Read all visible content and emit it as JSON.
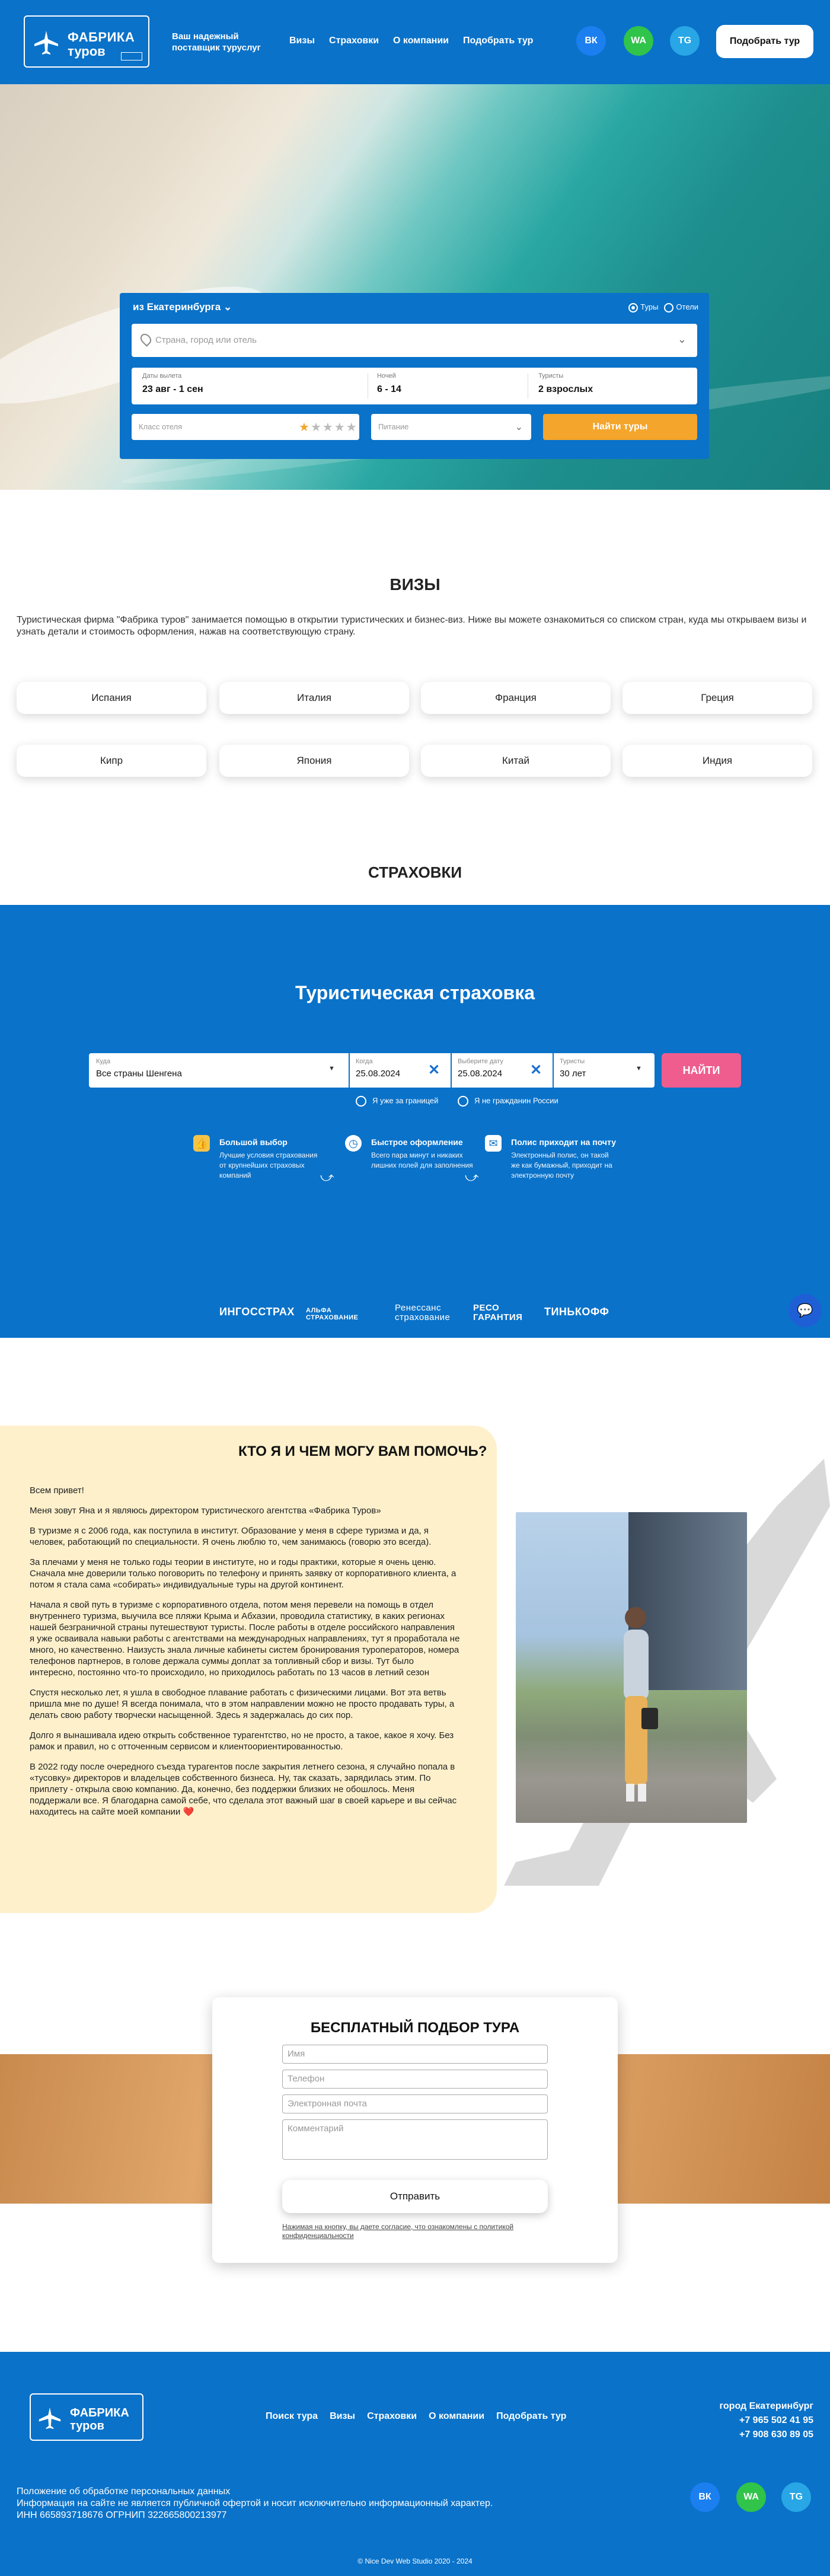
{
  "header": {
    "logo_line1": "ФАБРИКА",
    "logo_line2": "туров",
    "tagline": "Ваш надежный поставщик туруслуг",
    "nav": [
      "Визы",
      "Страховки",
      "О компании",
      "Подобрать тур"
    ],
    "social": [
      "ВК",
      "WA",
      "TG"
    ],
    "cta": "Подобрать тур"
  },
  "hero": {
    "from": "из Екатеринбурга ⌄",
    "radio_tours": "Туры",
    "radio_hotels": "Отели",
    "dest_placeholder": "Страна, город или отель",
    "dates_label": "Даты вылета",
    "dates_value": "23 авг - 1 сен",
    "nights_label": "Ночей",
    "nights_value": "6 - 14",
    "tourists_label": "Туристы",
    "tourists_value": "2 взрослых",
    "class_placeholder": "Класс отеля",
    "stars_on": "★",
    "stars_off": "★★★★",
    "food_placeholder": "Питание",
    "find": "Найти туры"
  },
  "visas": {
    "title": "ВИЗЫ",
    "desc": "Туристическая фирма \"Фабрика туров\" занимается помощью в открытии туристических и бизнес-виз. Ниже вы можете ознакомиться со списком стран, куда мы открываем визы и узнать детали и стоимость оформления, нажав на соответствующую страну.",
    "countries": [
      "Испания",
      "Италия",
      "Франция",
      "Греция",
      "Кипр",
      "Япония",
      "Китай",
      "Индия"
    ]
  },
  "insurance": {
    "section_title": "СТРАХОВКИ",
    "heading": "Туристическая страховка",
    "where_label": "Куда",
    "where_value": "Все страны Шенгена",
    "when_label": "Когда",
    "when_value": "25.08.2024",
    "back_label": "Выберите дату",
    "back_value": "25.08.2024",
    "tourists_label": "Туристы",
    "tourists_value": "30 лет",
    "find": "НАЙТИ",
    "check1": "Я уже за границей",
    "check2": "Я не гражданин России",
    "features": [
      {
        "title": "Большой выбор",
        "desc": "Лучшие условия страхования от крупнейших страховых компаний"
      },
      {
        "title": "Быстрое оформление",
        "desc": "Всего пара минут и никаких лишних полей для заполнения"
      },
      {
        "title": "Полис приходит на почту",
        "desc": "Электронный полис, он такой же как бумажный, приходит на электронную почту"
      }
    ],
    "brands": [
      "ИНГОССТРАХ",
      "АЛЬФА СТРАХОВАНИЕ",
      "Ренессанс страхование",
      "РЕСО ГАРАНТИЯ",
      "ТИНЬКОФФ"
    ]
  },
  "about": {
    "title": "КТО Я И ЧЕМ МОГУ ВАМ ПОМОЧЬ?",
    "p1": "Всем привет!",
    "p2": "Меня зовут Яна и я являюсь директором туристического агентства «Фабрика Туров»",
    "p3": "В туризме я с 2006 года, как поступила в институт. Образование у меня в сфере туризма и да, я человек, работающий по специальности. Я очень люблю то, чем занимаюсь (говорю это всегда).",
    "p4": "За плечами у меня не только годы теории в институте, но и годы практики, которые я очень ценю. Сначала мне доверили только поговорить по телефону и принять заявку от корпоративного клиента, а потом я стала сама «собирать» индивидуальные туры на другой континент.",
    "p5": "Начала я свой путь в туризме с корпоративного отдела, потом меня перевели на помощь в отдел внутреннего туризма, выучила все пляжи Крыма и Абхазии, проводила статистику, в каких регионах нашей безграничной страны путешествуют туристы. После работы в отделе российского направления я уже осваивала навыки работы с агентствами на международных направлениях, тут я проработала не много, но качественно. Наизусть знала личные кабинеты систем бронирования туроператоров, номера телефонов партнеров, в голове держала суммы доплат за топливный сбор и визы. Тут было интересно, постоянно что-то происходило, но приходилось работать по 13 часов в летний сезон",
    "p6": "Спустя несколько лет, я ушла в свободное плавание работать с физическими лицами. Вот эта ветвь пришла мне по душе! Я всегда понимала, что в этом направлении можно не просто продавать туры, а делать свою работу творчески насыщенной. Здесь я задержалась до сих пор.",
    "p7": "Долго я вынашивала идею открыть собственное турагентство, но не просто, а такое, какое я хочу. Без рамок и правил, но с отточенным сервисом и клиентоориентированностью.",
    "p8": "В 2022 году после очередного съезда турагентов после закрытия летнего сезона, я случайно попала в «тусовку» директоров и владельцев собственного бизнеса. Ну, так сказать, зарядилась этим. По приплету - открыла свою компанию. Да, конечно, без поддержки близких не обошлось. Меня поддержали все. Я благодарна самой себе, что сделала этот важный шаг в своей карьере и вы сейчас находитесь на сайте моей компании ❤️"
  },
  "lead": {
    "title": "БЕСПЛАТНЫЙ ПОДБОР ТУРА",
    "name": "Имя",
    "phone": "Телефон",
    "email": "Электронная почта",
    "comment": "Комментарий",
    "submit": "Отправить",
    "note": "Нажимая на кнопку, вы даете согласие, что ознакомлены с политикой конфиденциальности"
  },
  "footer": {
    "logo_line1": "ФАБРИКА",
    "logo_line2": "туров",
    "nav": [
      "Поиск тура",
      "Визы",
      "Страховки",
      "О компании",
      "Подобрать тур"
    ],
    "city": "город Екатеринбург",
    "phone1": "+7 965 502 41 95",
    "phone2": "+7 908 630 89 05",
    "legal1": "Положение об обработке персональных данных",
    "legal2": "Информация на сайте не является публичной офертой и носит исключительно информационный характер.",
    "legal3": "ИНН 665893718676 ОГРНИП 322665800213977",
    "copyright": "© Nice Dev Web Studio 2020 - 2024"
  }
}
